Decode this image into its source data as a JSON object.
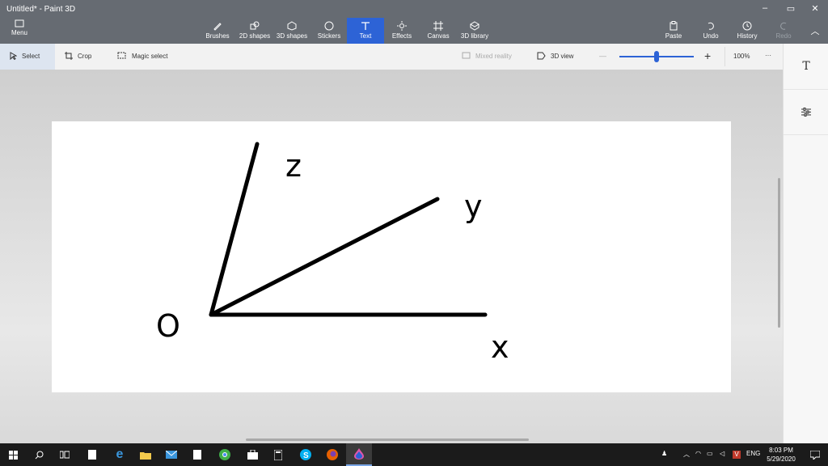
{
  "titlebar": {
    "title": "Untitled* - Paint 3D",
    "menu_label": "Menu",
    "minimize": "–",
    "restore": "▭",
    "close": "✕"
  },
  "tools": [
    {
      "label": "Brushes",
      "icon": "brush-icon"
    },
    {
      "label": "2D shapes",
      "icon": "2d-shapes-icon"
    },
    {
      "label": "3D shapes",
      "icon": "3d-shapes-icon"
    },
    {
      "label": "Stickers",
      "icon": "stickers-icon"
    },
    {
      "label": "Text",
      "icon": "text-icon",
      "active": true
    },
    {
      "label": "Effects",
      "icon": "effects-icon"
    },
    {
      "label": "Canvas",
      "icon": "canvas-icon"
    },
    {
      "label": "3D library",
      "icon": "3d-library-icon"
    }
  ],
  "actions": {
    "paste": "Paste",
    "undo": "Undo",
    "history": "History",
    "redo": "Redo"
  },
  "toolbar": {
    "select": "Select",
    "crop": "Crop",
    "magic_select": "Magic select",
    "mixed_reality": "Mixed reality",
    "view_3d": "3D view",
    "zoom_minus": "—",
    "zoom_plus": "+",
    "zoom": "100%",
    "more": "···"
  },
  "zoom_level": 1.0,
  "canvas": {
    "labels": {
      "z": "z",
      "y": "y",
      "o": "O",
      "x": "x"
    }
  },
  "rightpanel": {
    "text_icon": "T",
    "settings_icon": "sliders-icon"
  },
  "taskbar": {
    "language": "ENG",
    "time": "8:03 PM",
    "date": "5/29/2020"
  },
  "colors": {
    "accent": "#2d63d6",
    "titlebar": "#666b72",
    "taskbar": "#1b1b1b"
  }
}
